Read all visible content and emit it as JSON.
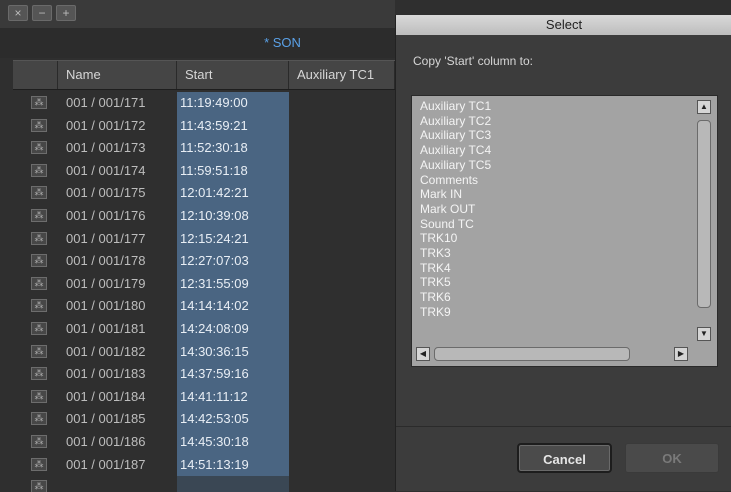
{
  "window": {
    "controls": [
      "×",
      "−",
      "+"
    ],
    "bin_title": "* SON"
  },
  "table": {
    "columns": [
      "Name",
      "Start",
      "Auxiliary TC1"
    ],
    "rows": [
      {
        "name": "001 / 001/171",
        "start": "11:19:49:00"
      },
      {
        "name": "001 / 001/172",
        "start": "11:43:59:21"
      },
      {
        "name": "001 / 001/173",
        "start": "11:52:30:18"
      },
      {
        "name": "001 / 001/174",
        "start": "11:59:51:18"
      },
      {
        "name": "001 / 001/175",
        "start": "12:01:42:21"
      },
      {
        "name": "001 / 001/176",
        "start": "12:10:39:08"
      },
      {
        "name": "001 / 001/177",
        "start": "12:15:24:21"
      },
      {
        "name": "001 / 001/178",
        "start": "12:27:07:03"
      },
      {
        "name": "001 / 001/179",
        "start": "12:31:55:09"
      },
      {
        "name": "001 / 001/180",
        "start": "14:14:14:02"
      },
      {
        "name": "001 / 001/181",
        "start": "14:24:08:09"
      },
      {
        "name": "001 / 001/182",
        "start": "14:30:36:15"
      },
      {
        "name": "001 / 001/183",
        "start": "14:37:59:16"
      },
      {
        "name": "001 / 001/184",
        "start": "14:41:11:12"
      },
      {
        "name": "001 / 001/185",
        "start": "14:42:53:05"
      },
      {
        "name": "001 / 001/186",
        "start": "14:45:30:18"
      },
      {
        "name": "001 / 001/187",
        "start": "14:51:13:19"
      }
    ]
  },
  "dialog": {
    "title": "Select",
    "prompt": "Copy 'Start' column to:",
    "options": [
      "Auxiliary TC1",
      "Auxiliary TC2",
      "Auxiliary TC3",
      "Auxiliary TC4",
      "Auxiliary TC5",
      "Comments",
      "Mark IN",
      "Mark OUT",
      "Sound TC",
      "TRK10",
      "TRK3",
      "TRK4",
      "TRK5",
      "TRK6",
      "TRK9"
    ],
    "cancel_label": "Cancel",
    "ok_label": "OK"
  },
  "icons": {
    "clip": "audio-clip-icon",
    "scroll_up": "scroll-up-arrow-icon",
    "scroll_down": "scroll-down-arrow-icon",
    "scroll_left": "scroll-left-arrow-icon",
    "scroll_right": "scroll-right-arrow-icon"
  },
  "colors": {
    "start_highlight": "#4a6582",
    "bin_title": "#5aa0e6"
  }
}
